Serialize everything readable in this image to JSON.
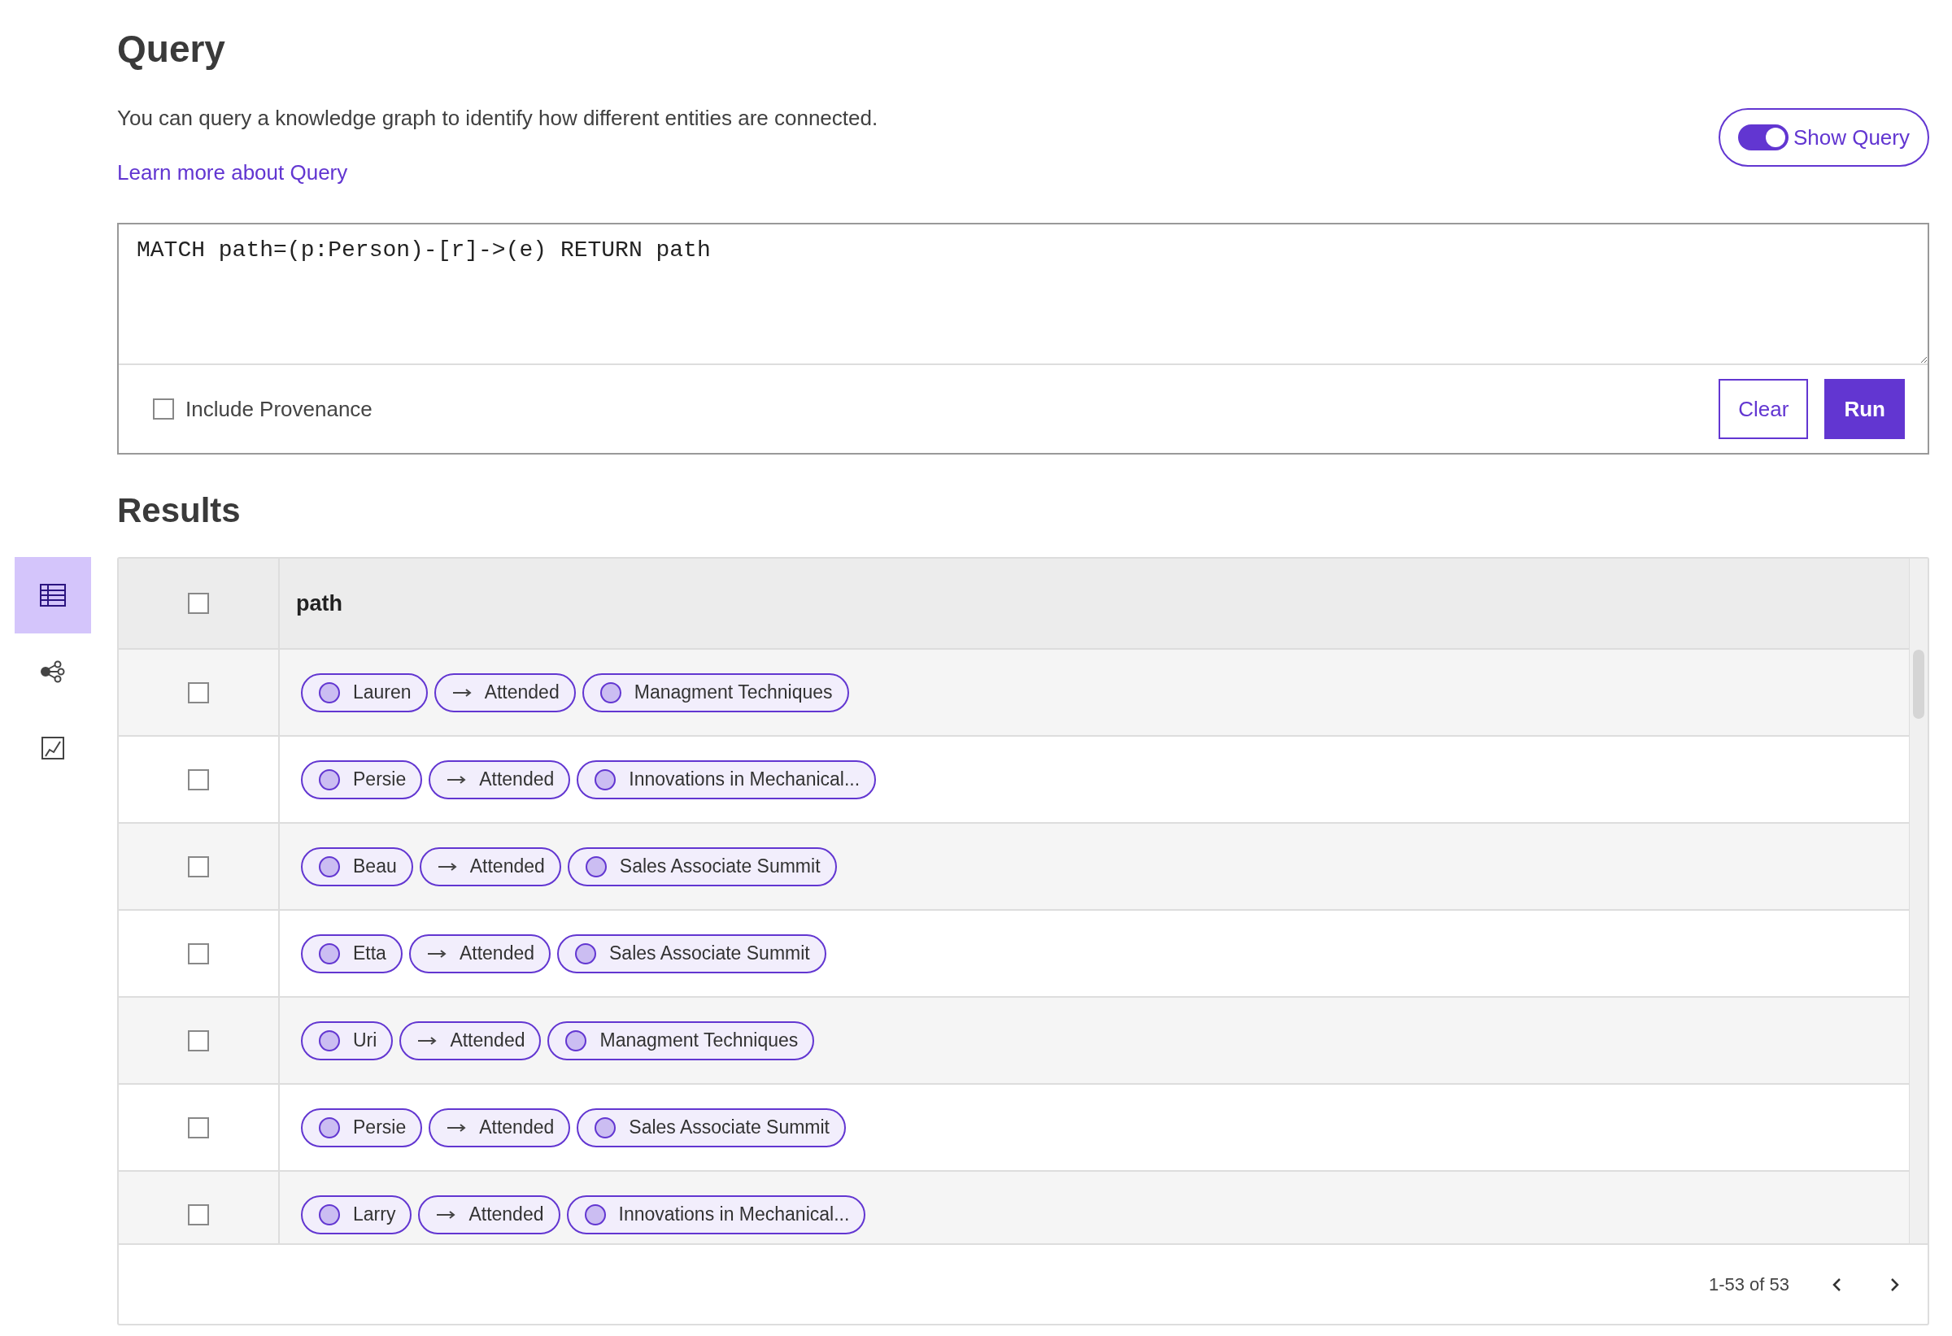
{
  "sidebar": {
    "items": [
      {
        "kind": "table",
        "selected": true
      },
      {
        "kind": "graph",
        "selected": false
      },
      {
        "kind": "chart",
        "selected": false
      }
    ]
  },
  "header": {
    "title": "Query",
    "description": "You can query a knowledge graph to identify how different entities are connected.",
    "link": "Learn more about Query"
  },
  "show_query": {
    "label": "Show Query",
    "on": true
  },
  "editor": {
    "value": "MATCH path=(p:Person)-[r]->(e) RETURN path",
    "include_provenance": {
      "label": "Include Provenance",
      "checked": false
    },
    "buttons": [
      {
        "kind": "secondary",
        "label": "Clear"
      },
      {
        "kind": "primary",
        "label": "Run"
      }
    ]
  },
  "results": {
    "title": "Results",
    "select_all": {
      "checked": false
    },
    "columns": [
      "path"
    ],
    "rows": [
      {
        "checked": false,
        "chips": [
          {
            "kind": "node",
            "label": "Lauren"
          },
          {
            "kind": "edge",
            "label": "Attended"
          },
          {
            "kind": "node",
            "label": "Managment Techniques"
          }
        ]
      },
      {
        "checked": false,
        "chips": [
          {
            "kind": "node",
            "label": "Persie"
          },
          {
            "kind": "edge",
            "label": "Attended"
          },
          {
            "kind": "node",
            "label": "Innovations in Mechanical..."
          }
        ]
      },
      {
        "checked": false,
        "chips": [
          {
            "kind": "node",
            "label": "Beau"
          },
          {
            "kind": "edge",
            "label": "Attended"
          },
          {
            "kind": "node",
            "label": "Sales Associate Summit"
          }
        ]
      },
      {
        "checked": false,
        "chips": [
          {
            "kind": "node",
            "label": "Etta"
          },
          {
            "kind": "edge",
            "label": "Attended"
          },
          {
            "kind": "node",
            "label": "Sales Associate Summit"
          }
        ]
      },
      {
        "checked": false,
        "chips": [
          {
            "kind": "node",
            "label": "Uri"
          },
          {
            "kind": "edge",
            "label": "Attended"
          },
          {
            "kind": "node",
            "label": "Managment Techniques"
          }
        ]
      },
      {
        "checked": false,
        "chips": [
          {
            "kind": "node",
            "label": "Persie"
          },
          {
            "kind": "edge",
            "label": "Attended"
          },
          {
            "kind": "node",
            "label": "Sales Associate Summit"
          }
        ]
      },
      {
        "checked": false,
        "chips": [
          {
            "kind": "node",
            "label": "Larry"
          },
          {
            "kind": "edge",
            "label": "Attended"
          },
          {
            "kind": "node",
            "label": "Innovations in Mechanical..."
          }
        ]
      }
    ],
    "pagination": {
      "range": "1-53 of 53"
    }
  }
}
